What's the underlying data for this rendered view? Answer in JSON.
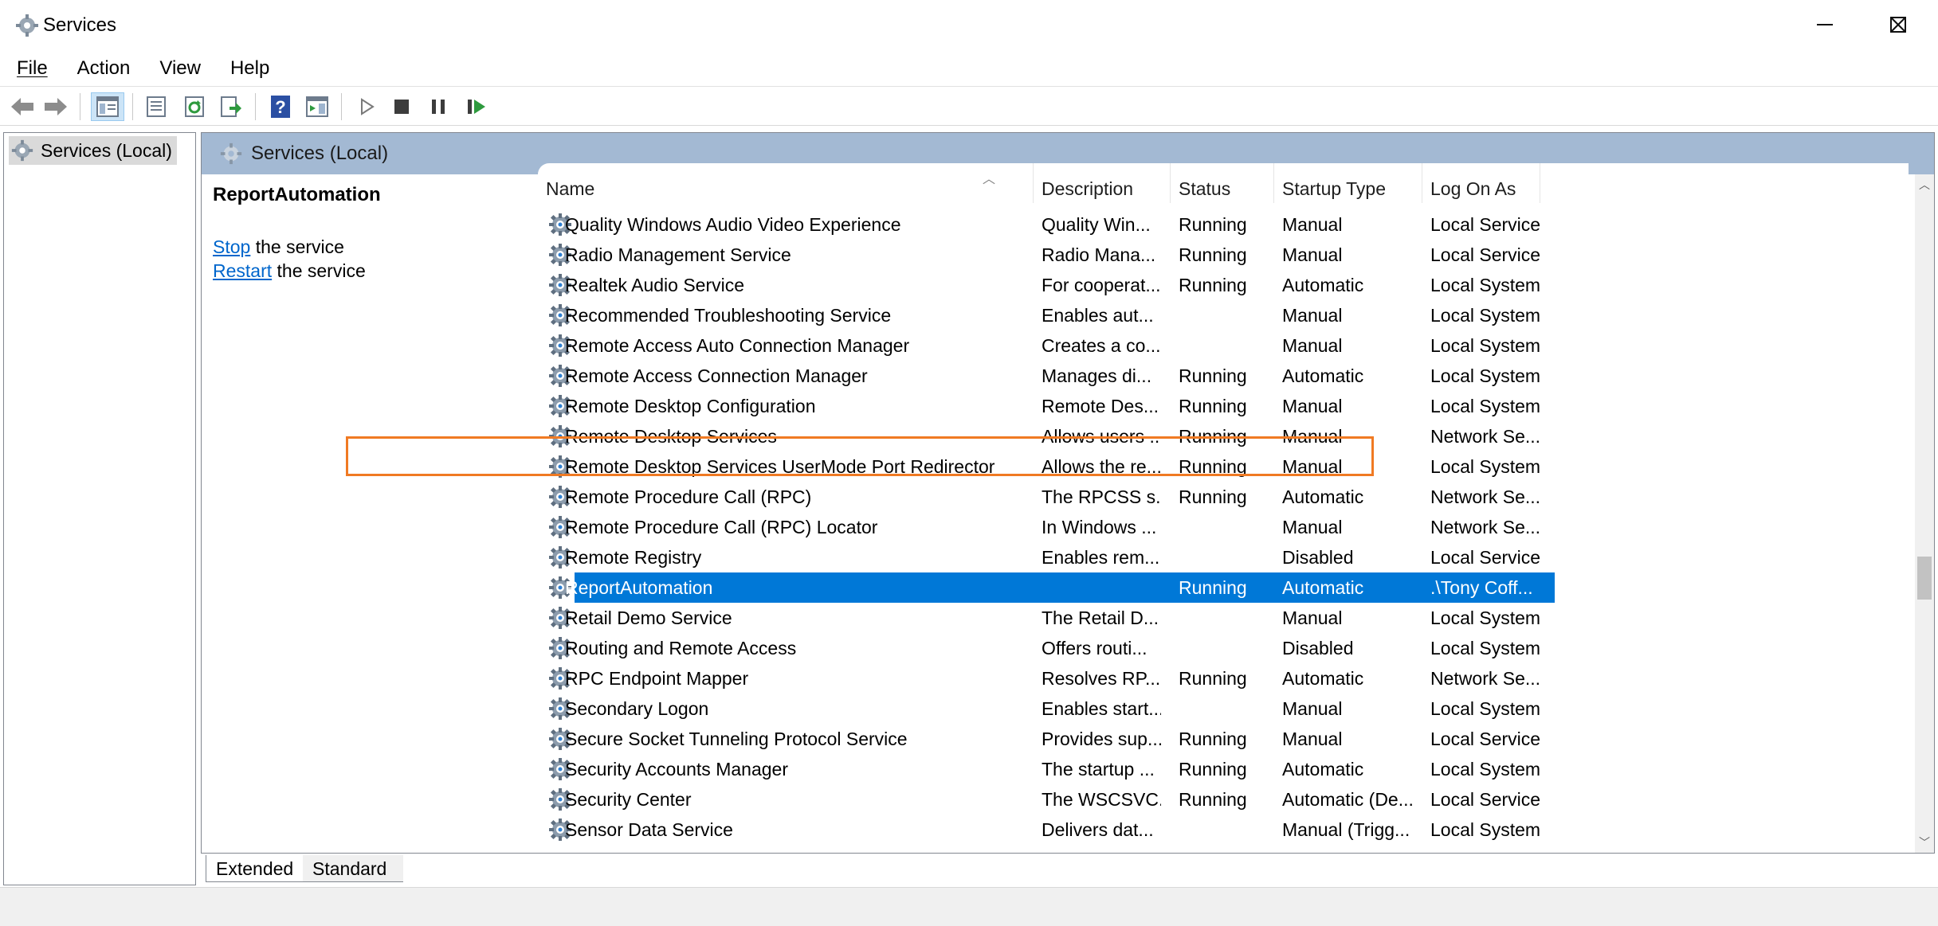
{
  "window": {
    "title": "Services",
    "minimize_icon": "minimize-icon",
    "maximize_icon": "maximize-icon",
    "close_icon": "close-icon"
  },
  "menu": {
    "items": [
      "File",
      "Action",
      "View",
      "Help"
    ]
  },
  "toolbar": {
    "buttons": [
      "back-arrow-icon",
      "forward-arrow-icon",
      "show-hide-console-tree-icon",
      "properties-icon",
      "refresh-icon",
      "export-list-icon",
      "help-icon",
      "show-hide-action-pane-icon",
      "start-service-icon",
      "stop-service-icon",
      "pause-service-icon",
      "restart-service-icon"
    ]
  },
  "tree": {
    "root_label": "Services (Local)"
  },
  "main": {
    "header_title": "Services (Local)",
    "details": {
      "service_name": "ReportAutomation",
      "stop_link": "Stop",
      "stop_suffix": " the service",
      "restart_link": "Restart",
      "restart_suffix": " the service"
    },
    "columns": [
      "Name",
      "Description",
      "Status",
      "Startup Type",
      "Log On As"
    ],
    "rows": [
      [
        "Quality Windows Audio Video Experience",
        "Quality Win...",
        "Running",
        "Manual",
        "Local Service"
      ],
      [
        "Radio Management Service",
        "Radio Mana...",
        "Running",
        "Manual",
        "Local Service"
      ],
      [
        "Realtek Audio Service",
        "For cooperat...",
        "Running",
        "Automatic",
        "Local System"
      ],
      [
        "Recommended Troubleshooting Service",
        "Enables aut...",
        "",
        "Manual",
        "Local System"
      ],
      [
        "Remote Access Auto Connection Manager",
        "Creates a co...",
        "",
        "Manual",
        "Local System"
      ],
      [
        "Remote Access Connection Manager",
        "Manages di...",
        "Running",
        "Automatic",
        "Local System"
      ],
      [
        "Remote Desktop Configuration",
        "Remote Des...",
        "Running",
        "Manual",
        "Local System"
      ],
      [
        "Remote Desktop Services",
        "Allows users ...",
        "Running",
        "Manual",
        "Network Se..."
      ],
      [
        "Remote Desktop Services UserMode Port Redirector",
        "Allows the re...",
        "Running",
        "Manual",
        "Local System"
      ],
      [
        "Remote Procedure Call (RPC)",
        "The RPCSS s...",
        "Running",
        "Automatic",
        "Network Se..."
      ],
      [
        "Remote Procedure Call (RPC) Locator",
        "In Windows ...",
        "",
        "Manual",
        "Network Se..."
      ],
      [
        "Remote Registry",
        "Enables rem...",
        "",
        "Disabled",
        "Local Service"
      ],
      [
        "ReportAutomation",
        "",
        "Running",
        "Automatic",
        ".\\Tony Coff..."
      ],
      [
        "Retail Demo Service",
        "The Retail D...",
        "",
        "Manual",
        "Local System"
      ],
      [
        "Routing and Remote Access",
        "Offers routi...",
        "",
        "Disabled",
        "Local System"
      ],
      [
        "RPC Endpoint Mapper",
        "Resolves RP...",
        "Running",
        "Automatic",
        "Network Se..."
      ],
      [
        "Secondary Logon",
        "Enables start...",
        "",
        "Manual",
        "Local System"
      ],
      [
        "Secure Socket Tunneling Protocol Service",
        "Provides sup...",
        "Running",
        "Manual",
        "Local Service"
      ],
      [
        "Security Accounts Manager",
        "The startup ...",
        "Running",
        "Automatic",
        "Local System"
      ],
      [
        "Security Center",
        "The WSCSVC...",
        "Running",
        "Automatic (De...",
        "Local Service"
      ],
      [
        "Sensor Data Service",
        "Delivers dat...",
        "",
        "Manual (Trigg...",
        "Local System"
      ]
    ],
    "selected_index": 12
  },
  "tabs": [
    "Extended",
    "Standard"
  ],
  "colors": {
    "selection": "#0078d7",
    "highlight_border": "#f07a23",
    "header_band": "#a3b9d3",
    "link": "#0066cc"
  }
}
